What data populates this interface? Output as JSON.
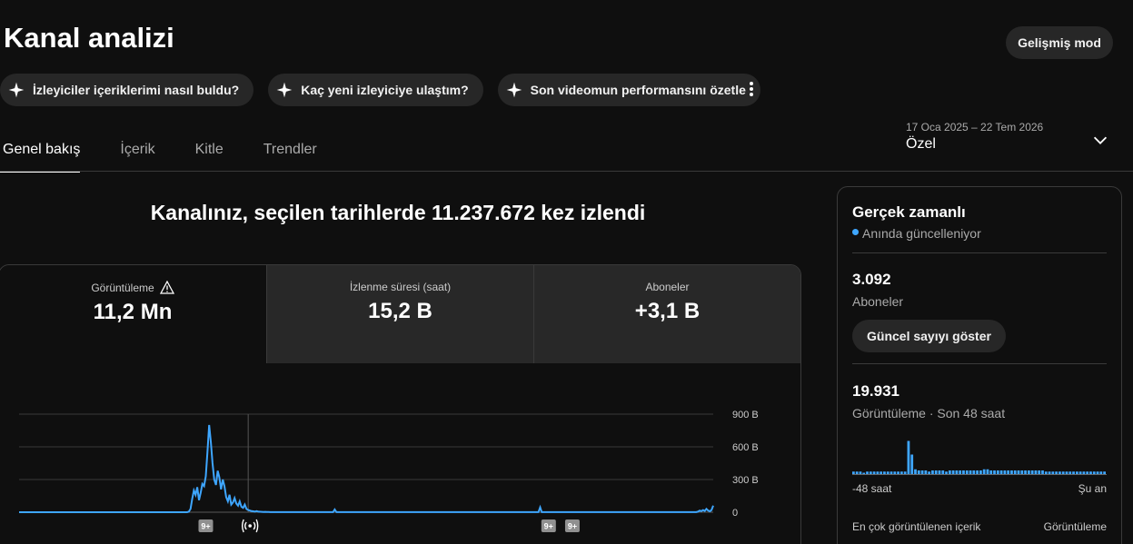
{
  "page": {
    "title": "Kanal analizi",
    "advanced_mode": "Gelişmiş mod"
  },
  "chips": [
    {
      "label": "İzleyiciler içeriklerimi nasıl buldu?"
    },
    {
      "label": "Kaç yeni izleyiciye ulaştım?"
    },
    {
      "label": "Son videomun performansını özetle"
    }
  ],
  "tabs": [
    {
      "label": "Genel bakış",
      "active": true
    },
    {
      "label": "İçerik"
    },
    {
      "label": "Kitle"
    },
    {
      "label": "Trendler"
    }
  ],
  "date_range": {
    "range": "17 Oca 2025 – 22 Tem 2026",
    "label": "Özel"
  },
  "headline": "Kanalınız, seçilen tarihlerde 11.237.672 kez izlendi",
  "metrics": [
    {
      "label": "Görüntüleme",
      "value": "11,2 Mn",
      "warning": true
    },
    {
      "label": "İzlenme süresi (saat)",
      "value": "15,2 B"
    },
    {
      "label": "Aboneler",
      "value": "+3,1 B"
    }
  ],
  "chart_data": {
    "type": "line",
    "y_tick_labels": [
      "900 B",
      "600 B",
      "300 B",
      "0"
    ],
    "ylim": [
      0,
      900000
    ],
    "color": "#3ea6ff",
    "values": [
      0,
      0,
      0,
      0,
      0,
      0,
      0,
      0,
      0,
      0,
      0,
      0,
      0,
      0,
      0,
      0,
      0,
      0,
      0,
      0,
      0,
      0,
      0,
      0,
      0,
      0,
      0,
      0,
      0,
      0,
      0,
      0,
      0,
      0,
      0,
      0,
      0,
      0,
      0,
      0,
      0,
      0,
      0,
      0,
      0,
      0,
      0,
      0,
      0,
      0,
      0,
      0,
      0,
      0,
      0,
      0,
      0,
      0,
      0,
      0,
      0,
      0,
      0,
      0,
      0,
      0,
      0,
      0,
      0,
      0,
      0,
      0,
      0,
      0,
      0,
      0,
      0,
      0,
      0,
      0,
      0,
      0,
      0,
      0,
      0,
      0,
      0,
      0,
      0,
      0,
      0,
      0,
      0,
      0,
      0,
      0,
      0,
      0,
      0,
      0,
      5000,
      30000,
      120000,
      200000,
      160000,
      230000,
      110000,
      180000,
      260000,
      240000,
      330000,
      550000,
      800000,
      640000,
      450000,
      300000,
      250000,
      380000,
      320000,
      210000,
      300000,
      240000,
      140000,
      100000,
      160000,
      70000,
      90000,
      130000,
      80000,
      60000,
      100000,
      50000,
      40000,
      70000,
      30000,
      20000,
      15000,
      10000,
      8000,
      6000,
      10000,
      5000,
      4000,
      3000,
      2000,
      3000,
      2000,
      2000,
      1000,
      1000,
      1000,
      1000,
      1000,
      1000,
      1000,
      1000,
      1000,
      1000,
      1000,
      1000,
      1000,
      1000,
      1000,
      1000,
      1000,
      1000,
      1000,
      1000,
      1000,
      1000,
      1000,
      1000,
      1000,
      1000,
      1000,
      1000,
      1000,
      1000,
      1000,
      1000,
      1000,
      1000,
      1000,
      1000,
      1000,
      1000,
      25000,
      1000,
      1000,
      1000,
      1000,
      1000,
      1000,
      1000,
      1000,
      1000,
      1000,
      1000,
      1000,
      1000,
      1000,
      1000,
      1000,
      1000,
      1000,
      1000,
      1000,
      1000,
      1000,
      1000,
      1000,
      1000,
      1000,
      1000,
      1000,
      1000,
      1000,
      1000,
      1000,
      1000,
      1000,
      1000,
      1000,
      1000,
      1000,
      1000,
      1000,
      1000,
      1000,
      1000,
      1000,
      1000,
      1000,
      1000,
      1000,
      1000,
      1000,
      1000,
      1000,
      1000,
      1000,
      1000,
      1000,
      1000,
      1000,
      1000,
      1000,
      1000,
      1000,
      1000,
      1000,
      1000,
      1000,
      1000,
      1000,
      1000,
      1000,
      1000,
      1000,
      1000,
      1000,
      1000,
      1000,
      1000,
      1000,
      1000,
      1000,
      1000,
      1000,
      1000,
      1000,
      1000,
      1000,
      1000,
      1000,
      1000,
      1000,
      1000,
      1000,
      1000,
      1000,
      1000,
      1000,
      1000,
      1000,
      1000,
      1000,
      1000,
      1000,
      1000,
      1000,
      1000,
      1000,
      1000,
      1000,
      1000,
      1000,
      1000,
      1000,
      1000,
      1000,
      1000,
      1000,
      1000,
      1000,
      1000,
      1000,
      45000,
      1000,
      1000,
      1000,
      1000,
      1000,
      1000,
      1000,
      1000,
      1000,
      1000,
      1000,
      1000,
      1000,
      1000,
      1000,
      1000,
      1000,
      1000,
      1000,
      1000,
      1000,
      1000,
      1000,
      1000,
      1000,
      1000,
      1000,
      1000,
      1000,
      1000,
      1000,
      1000,
      1000,
      1000,
      1000,
      1000,
      1000,
      1000,
      1000,
      1000,
      1000,
      1000,
      1000,
      1000,
      1000,
      1000,
      1000,
      1000,
      1000,
      1000,
      1000,
      1000,
      1000,
      1000,
      1000,
      1000,
      1000,
      1000,
      1000,
      1000,
      1000,
      1000,
      1000,
      1000,
      1000,
      1000,
      1000,
      1000,
      1000,
      1000,
      1000,
      1000,
      1000,
      1000,
      1000,
      1000,
      1000,
      1000,
      1000,
      1000,
      1000,
      1000,
      1000,
      1000,
      1000,
      1000,
      1000,
      1000,
      1000,
      1000,
      1000,
      1000,
      5000,
      15000,
      10000,
      20000,
      12000,
      30000,
      15000,
      8000,
      20000,
      60000
    ],
    "marker_index": 135,
    "badges": [
      {
        "text": "9+",
        "index": 110
      },
      {
        "text": "9+",
        "index": 312
      },
      {
        "text": "9+",
        "index": 326
      }
    ]
  },
  "realtime": {
    "title": "Gerçek zamanlı",
    "live": "Anında güncelleniyor",
    "subscribers": "3.092",
    "subscribers_label": "Aboneler",
    "show_button": "Güncel sayıyı göster",
    "views": "19.931",
    "views_label": "Görüntüleme · Son 48 saat",
    "axis_start": "-48 saat",
    "axis_end": "Şu an",
    "bars": [
      3,
      3,
      3,
      2,
      3,
      3,
      3,
      3,
      3,
      3,
      3,
      3,
      3,
      3,
      3,
      3,
      30,
      18,
      5,
      4,
      4,
      4,
      3,
      4,
      4,
      4,
      4,
      3,
      4,
      4,
      4,
      4,
      4,
      4,
      4,
      4,
      4,
      4,
      5,
      5,
      4,
      4,
      4,
      4,
      4,
      4,
      4,
      4,
      4,
      4,
      4,
      4,
      4,
      4,
      4,
      4,
      3,
      3,
      3,
      3,
      3,
      3,
      3,
      3,
      3,
      3,
      3,
      3,
      3,
      3,
      3,
      3,
      3,
      3
    ],
    "bar_max": 32,
    "top_content_label": "En çok görüntülenen içerik",
    "views_column": "Görüntüleme"
  }
}
